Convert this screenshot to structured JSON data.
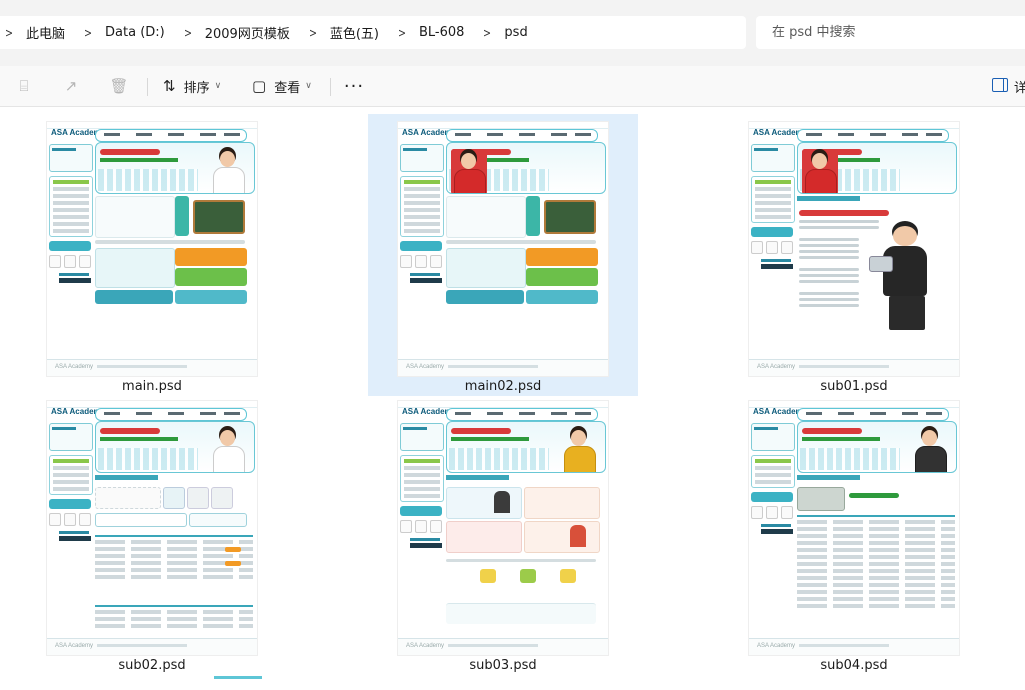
{
  "breadcrumb": {
    "items": [
      "此电脑",
      "Data (D:)",
      "2009网页模板",
      "蓝色(五)",
      "BL-608",
      "psd"
    ]
  },
  "search": {
    "placeholder": "在 psd 中搜索"
  },
  "toolbar": {
    "sort_label": "排序",
    "view_label": "查看",
    "more_label": "···",
    "details_label": "详"
  },
  "files": [
    {
      "name": "main.psd",
      "selected": false,
      "variant": "main"
    },
    {
      "name": "main02.psd",
      "selected": true,
      "variant": "main"
    },
    {
      "name": "sub01.psd",
      "selected": false,
      "variant": "sub01"
    },
    {
      "name": "sub02.psd",
      "selected": false,
      "variant": "sub02"
    },
    {
      "name": "sub03.psd",
      "selected": false,
      "variant": "sub03"
    },
    {
      "name": "sub04.psd",
      "selected": false,
      "variant": "sub04"
    }
  ],
  "thumb_logo": "ASA Academy",
  "colors": {
    "selection": "#e0eefb",
    "accent_teal": "#3aa6b9",
    "address_bar_bg": "#f3f3f3"
  }
}
